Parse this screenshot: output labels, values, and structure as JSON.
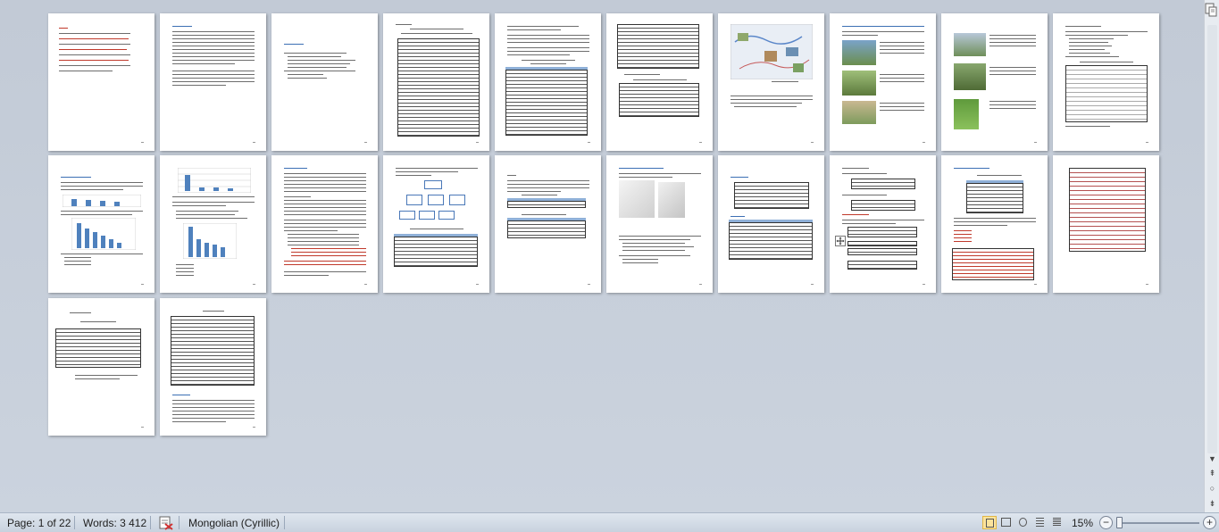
{
  "status_bar": {
    "page": "Page: 1 of 22",
    "words": "Words: 3 412",
    "language": "Mongolian (Cyrillic)",
    "zoom": "15%",
    "zoom_minus": "−",
    "zoom_plus": "+"
  },
  "scrollbar": {
    "up": "▲",
    "down": "▼",
    "prev_page": "⇞",
    "browse_object": "○",
    "next_page": "⇟"
  },
  "icons": {
    "proofing": "proofing-error-icon",
    "view_print_layout": "print-layout-icon",
    "view_full_screen_reading": "full-screen-reading-icon",
    "view_web_layout": "web-layout-icon",
    "view_outline": "outline-icon",
    "view_draft": "draft-icon",
    "move_handle": "table-move-handle-icon"
  },
  "colors": {
    "chart_bar": "#4f81bd",
    "red_text": "#c0392b",
    "active_view": "#fbe39c"
  }
}
